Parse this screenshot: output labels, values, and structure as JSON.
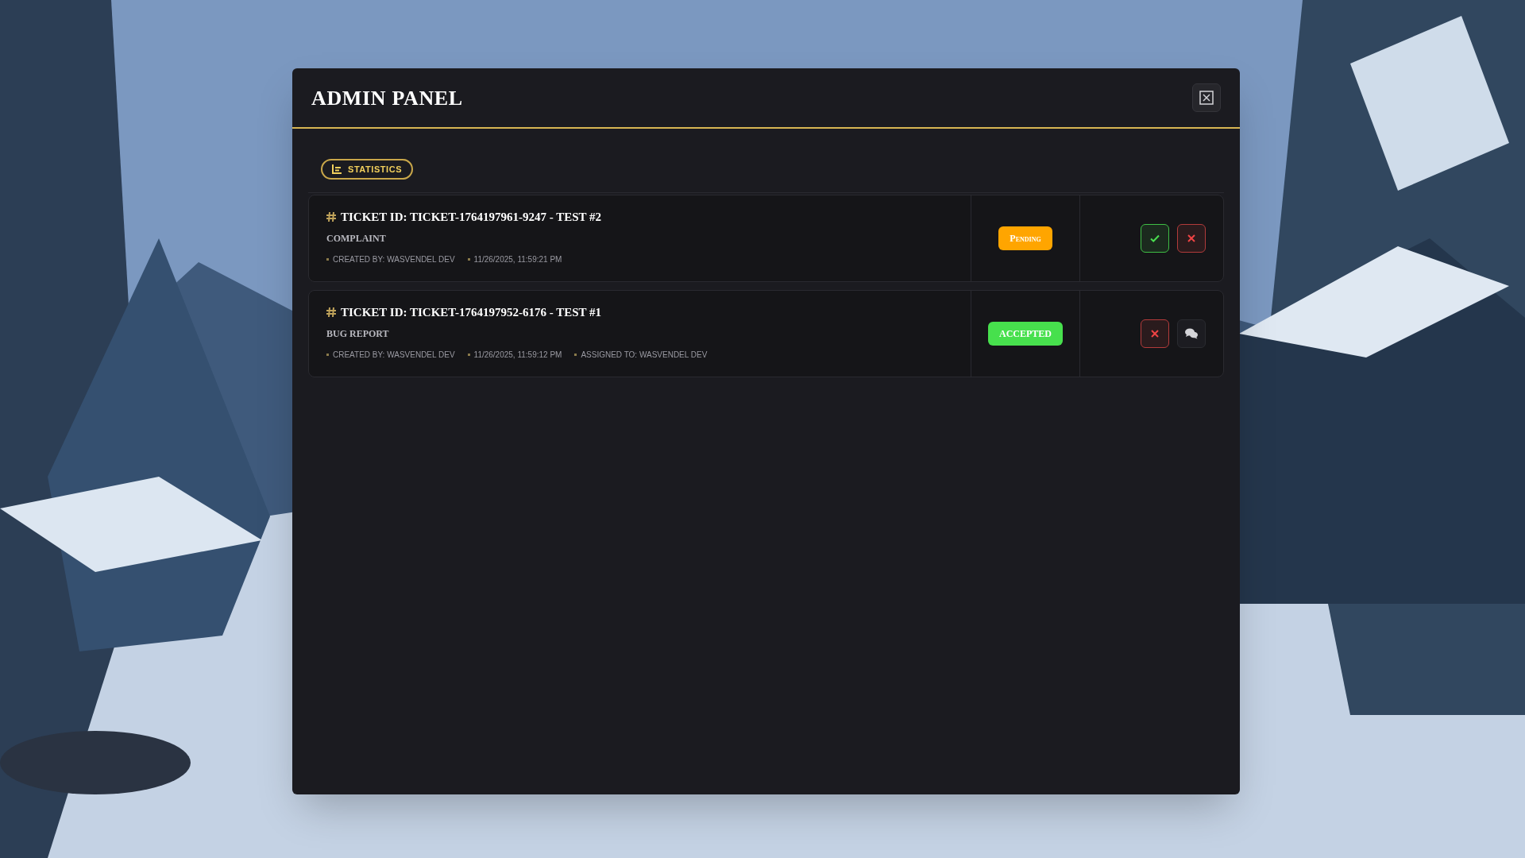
{
  "window": {
    "title": "ADMIN PANEL"
  },
  "toolbar": {
    "statistics_button": "STATISTICS"
  },
  "tickets": [
    {
      "title": "TICKET ID: TICKET-1764197961-9247 - TEST #2",
      "category": "COMPLAINT",
      "meta": [
        "CREATED BY: WASVENDEL DEV",
        "11/26/2025, 11:59:21 PM"
      ],
      "status": {
        "label": "Pending",
        "kind": "pending"
      },
      "actions": [
        {
          "kind": "accept"
        },
        {
          "kind": "reject"
        }
      ]
    },
    {
      "title": "TICKET ID: TICKET-1764197952-6176 - TEST #1",
      "category": "BUG REPORT",
      "meta": [
        "CREATED BY: WASVENDEL DEV",
        "11/26/2025, 11:59:12 PM",
        "ASSIGNED TO: WASVENDEL DEV"
      ],
      "status": {
        "label": "ACCEPTED",
        "kind": "accepted"
      },
      "actions": [
        {
          "kind": "reject"
        },
        {
          "kind": "chat"
        }
      ]
    }
  ]
}
